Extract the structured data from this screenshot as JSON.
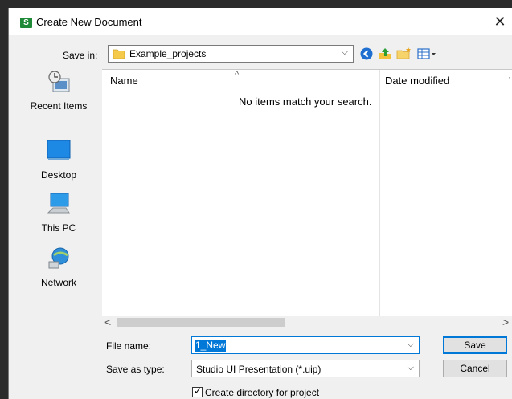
{
  "dialog": {
    "title": "Create New Document",
    "app_icon_letter": "S",
    "close_glyph": "✕"
  },
  "toolbar": {
    "save_in_label": "Save in:",
    "save_in_value": "Example_projects",
    "combo_arrow": "⌵",
    "icons": [
      "back-icon",
      "up-folder-icon",
      "new-folder-icon",
      "view-menu-icon"
    ]
  },
  "places": [
    {
      "label": "Recent Items",
      "icon": "recent-items-icon"
    },
    {
      "label": "Desktop",
      "icon": "desktop-icon"
    },
    {
      "label": "This PC",
      "icon": "this-pc-icon"
    },
    {
      "label": "Network",
      "icon": "network-icon"
    }
  ],
  "file_list": {
    "columns": [
      "Name",
      "Date modified"
    ],
    "sort_caret": "^",
    "empty_message": "No items match your search.",
    "scroll_left": "<",
    "scroll_right": ">"
  },
  "form": {
    "file_name_label": "File name:",
    "file_name_value": "1_New",
    "save_as_type_label": "Save as type:",
    "save_as_type_value": "Studio UI Presentation (*.uip)",
    "save_button": "Save",
    "cancel_button": "Cancel",
    "create_directory_label": "Create directory for project",
    "create_directory_checked": true
  },
  "colors": {
    "accent": "#0078d7",
    "app_icon": "#1f8a38"
  }
}
